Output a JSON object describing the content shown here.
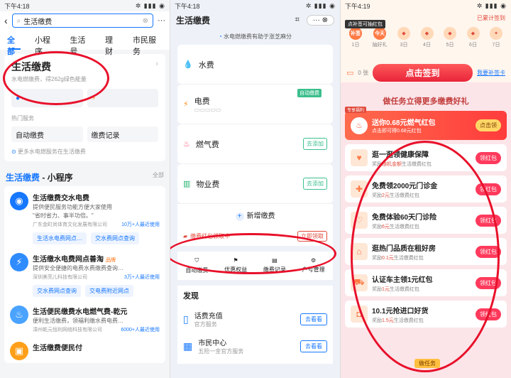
{
  "panel1": {
    "status_time": "下午4:18",
    "status_icons": "✲ ▮▮▮ ◉",
    "search_value": "生活缴费",
    "tabs": [
      "全部",
      "小程序",
      "生活号",
      "理财",
      "市民服务"
    ],
    "service": {
      "title": "生活缴费",
      "subtitle": "水电燃缴费，得262g绿色能量"
    },
    "hot_label": "热门服务",
    "hot_items": [
      "自动缴费",
      "缴费记录"
    ],
    "more_text": "更多水电燃服务在生活缴费",
    "section_prefix": "生活缴费",
    "section_suffix": " - 小程序",
    "all_label": "全部",
    "mini_programs": [
      {
        "title": "生活缴费交水电费",
        "desc1": "提供便民服务功能方便大家使用",
        "desc2": "\"省时省力、事半功倍。\"",
        "company": "广东金町尚体育文化发展有限公司",
        "users": "10万+人最近使用",
        "pills": [
          "生活水电费网点…",
          "交水费网点查询"
        ]
      },
      {
        "title": "生活缴水电费网点善淘",
        "badge": "品牌",
        "desc1": "提供安全便捷的电费水费缴费查询…",
        "company": "深圳美亮儿科技有限公司",
        "users": "3万+人最近使用",
        "pills": [
          "交水费网点查询",
          "交电费附近网点"
        ]
      },
      {
        "title": "生活便民缴费水电燃气费-乾元",
        "desc1": "便利生活缴费，领福利缴水费电费…",
        "company": "漳州乾元恒利网络科技有限公司",
        "users": "6000+人最近使用"
      },
      {
        "title": "生活缴费便民付"
      }
    ]
  },
  "panel2": {
    "status_time": "下午4:18",
    "status_icons": "✲ ▮▮▮ ◉",
    "title": "生活缴费",
    "notice": "水电燃缴费有助于涨芝麻分",
    "bills": [
      {
        "name": "水费",
        "sub": ""
      },
      {
        "name": "电费",
        "sub": "",
        "tag": "自动缴费"
      },
      {
        "name": "燃气费",
        "action": "去添加"
      },
      {
        "name": "物业费",
        "action": "去添加"
      }
    ],
    "new_bill": "新增缴费",
    "red_notice": "缴费红包领取中",
    "red_btn": "立即领取",
    "icons": [
      "自动缴费",
      "优惠权益",
      "缴费记录",
      "户号管理"
    ],
    "discover_title": "发现",
    "discover": [
      {
        "name": "话费充值",
        "sub": "官方服务",
        "btn": "去看看"
      },
      {
        "name": "市民中心",
        "sub": "五险一金官方服务",
        "btn": "去看看"
      }
    ]
  },
  "panel3": {
    "status_time": "下午4:19",
    "status_icons": "✲ ▮▮▮ ◉",
    "tooltip": "点补签可抽红包",
    "accumulated": "已累计签到",
    "days": [
      {
        "top": "补签",
        "label": "1日"
      },
      {
        "top": "今天",
        "label": "抽好礼"
      },
      {
        "top": "",
        "label": "3日"
      },
      {
        "top": "",
        "label": "4日"
      },
      {
        "top": "",
        "label": "5日"
      },
      {
        "top": "",
        "label": "6日"
      },
      {
        "top": "",
        "label": "7日"
      }
    ],
    "coupon": "0 张",
    "sign_btn": "点击签到",
    "makeup": "我要补签卡",
    "task_header": "做任务立得更多缴费好礼",
    "first_task": {
      "tag": "专享福利",
      "title": "送你0.68元燃气红包",
      "sub": "点击即可得0.68元红包",
      "btn": "点击领"
    },
    "tasks": [
      {
        "title": "逛一逛领健康保障",
        "reward": "随机金额",
        "unit": "生活缴费红包",
        "btn": "领红包"
      },
      {
        "title": "免费领2000元门诊金",
        "reward": "2元",
        "unit": "生活缴费红包",
        "btn": "领红包"
      },
      {
        "title": "免费体验60天门诊险",
        "reward": "6元",
        "unit": "生活缴费红包",
        "btn": "领红包"
      },
      {
        "title": "逛热门品质在租好房",
        "reward": "0.1元",
        "unit": "生活缴费红包",
        "btn": "领红包"
      },
      {
        "title": "认证车主领1元红包",
        "reward": "1元",
        "unit": "生活缴费红包",
        "btn": "领红包"
      },
      {
        "title": "10.1元抢进口好货",
        "reward": "1.5元",
        "unit": "生活缴费红包",
        "btn": "领红包"
      }
    ],
    "reward_prefix": "奖励",
    "bottom_tag": "做任务"
  }
}
